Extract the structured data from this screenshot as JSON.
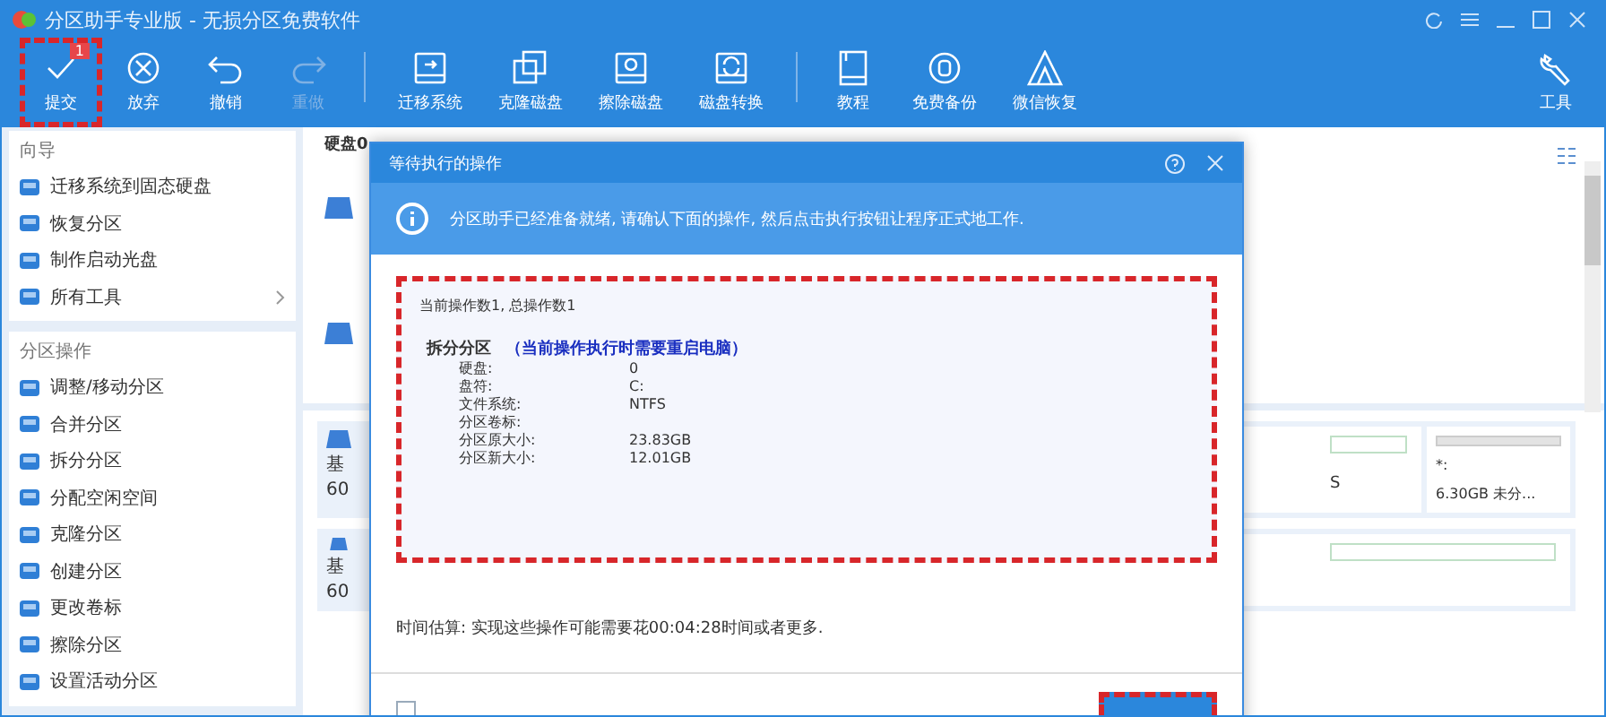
{
  "window": {
    "title": "分区助手专业版 - 无损分区免费软件"
  },
  "toolbar": [
    {
      "label": "提交",
      "kind": "check",
      "disabled": false,
      "highlighted": true,
      "badge": "1"
    },
    {
      "label": "放弃",
      "kind": "cancel",
      "disabled": false,
      "highlighted": false
    },
    {
      "label": "撤销",
      "kind": "undo",
      "disabled": false,
      "highlighted": false
    },
    {
      "label": "重做",
      "kind": "redo",
      "disabled": true,
      "highlighted": false
    },
    {
      "label": "迁移系统",
      "kind": "drive",
      "disabled": false,
      "highlighted": false,
      "group_start": true
    },
    {
      "label": "克隆磁盘",
      "kind": "clone",
      "disabled": false,
      "highlighted": false
    },
    {
      "label": "擦除磁盘",
      "kind": "wipe",
      "disabled": false,
      "highlighted": false
    },
    {
      "label": "磁盘转换",
      "kind": "convert",
      "disabled": false,
      "highlighted": false
    },
    {
      "label": "教程",
      "kind": "book",
      "disabled": false,
      "highlighted": false,
      "group_start": true
    },
    {
      "label": "免费备份",
      "kind": "backup",
      "disabled": false,
      "highlighted": false
    },
    {
      "label": "微信恢复",
      "kind": "wechat",
      "disabled": false,
      "highlighted": false
    }
  ],
  "tools_button": {
    "label": "工具"
  },
  "sidebar": {
    "sections": [
      {
        "title": "向导",
        "items": [
          {
            "label": "迁移系统到固态硬盘",
            "has_submenu": false
          },
          {
            "label": "恢复分区",
            "has_submenu": false
          },
          {
            "label": "制作启动光盘",
            "has_submenu": false
          },
          {
            "label": "所有工具",
            "has_submenu": true
          }
        ]
      },
      {
        "title": "分区操作",
        "items": [
          {
            "label": "调整/移动分区",
            "has_submenu": false
          },
          {
            "label": "合并分区",
            "has_submenu": false
          },
          {
            "label": "拆分分区",
            "has_submenu": false
          },
          {
            "label": "分配空闲空间",
            "has_submenu": false
          },
          {
            "label": "克隆分区",
            "has_submenu": false
          },
          {
            "label": "创建分区",
            "has_submenu": false
          },
          {
            "label": "更改卷标",
            "has_submenu": false
          },
          {
            "label": "擦除分区",
            "has_submenu": false
          },
          {
            "label": "设置活动分区",
            "has_submenu": false
          }
        ]
      }
    ]
  },
  "disk_panel": {
    "header": "硬盘0",
    "cards": [
      {
        "type_text": "基",
        "size_text": "60",
        "extra_text": "S",
        "unallocated": {
          "label": "*:",
          "size": "6.30GB 未分..."
        }
      },
      {
        "type_text": "基",
        "size_text": "60"
      }
    ]
  },
  "dialog": {
    "title": "等待执行的操作",
    "info": "分区助手已经准备就绪, 请确认下面的操作, 然后点击执行按钮让程序正式地工作.",
    "counts": "当前操作数1, 总操作数1",
    "operation": {
      "name": "拆分分区",
      "note": "（当前操作执行时需要重启电脑）",
      "details": [
        {
          "key": "硬盘:",
          "value": "0"
        },
        {
          "key": "盘符:",
          "value": "C:"
        },
        {
          "key": "文件系统:",
          "value": "NTFS"
        },
        {
          "key": "分区卷标:"
        },
        {
          "key": "分区原大小:",
          "value": "23.83GB"
        },
        {
          "key": "分区新大小:",
          "value": "12.01GB"
        }
      ]
    },
    "estimate": "时间估算: 实现这些操作可能需要花00:04:28时间或者更多.",
    "checkbox": {
      "checked": false
    }
  }
}
